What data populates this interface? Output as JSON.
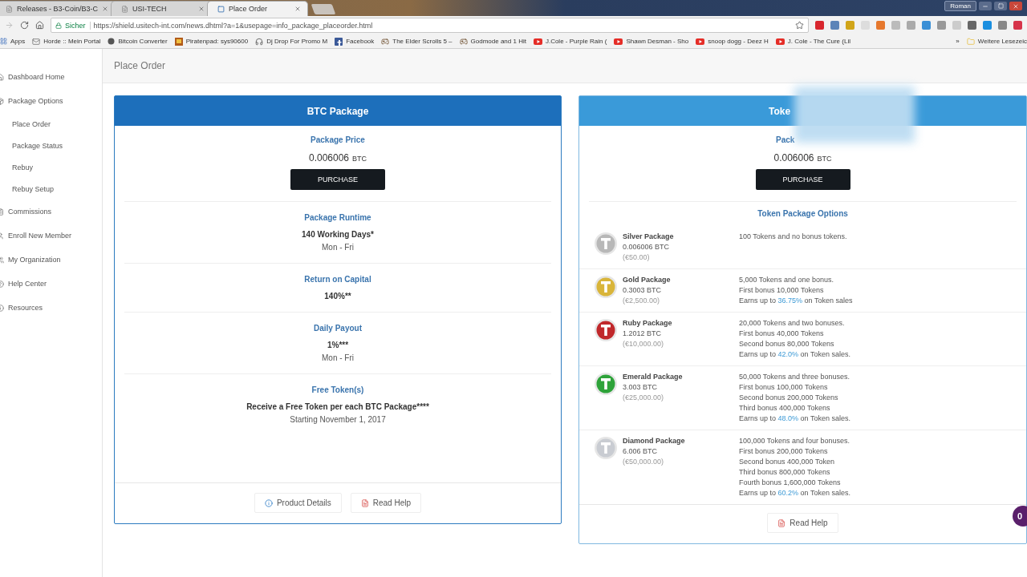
{
  "browser": {
    "tabs": [
      {
        "title": "Releases - B3-Coin/B3-C",
        "selected": false
      },
      {
        "title": "USI-TECH",
        "selected": false
      },
      {
        "title": "Place Order",
        "selected": true
      }
    ],
    "profile": "Roman",
    "address": {
      "security_label": "Sicher",
      "url": "https://shield.usitech-int.com/news.dhtml?a=1&usepage=info_package_placeorder.html"
    },
    "bookmarks": [
      {
        "label": "Apps",
        "kind": "apps"
      },
      {
        "label": "Horde :: Mein Portal",
        "kind": "mail"
      },
      {
        "label": "Bitcoin Converter",
        "kind": "letter"
      },
      {
        "label": "Piratenpad: sys90600",
        "kind": "pad"
      },
      {
        "label": "Dj Drop For Promo M",
        "kind": "headphones"
      },
      {
        "label": "Facebook",
        "kind": "facebook"
      },
      {
        "label": "The Elder Scrolls 5 –",
        "kind": "game"
      },
      {
        "label": "Godmode and 1 Hit",
        "kind": "game"
      },
      {
        "label": "J.Cole - Purple Rain (",
        "kind": "video"
      },
      {
        "label": "Shawn Desman - Sho",
        "kind": "video"
      },
      {
        "label": "snoop dogg - Deez H",
        "kind": "video"
      },
      {
        "label": "J. Cole - The Cure (Lil",
        "kind": "video"
      }
    ],
    "overflow": "»",
    "other_bookmarks": "Weitere Lesezeic"
  },
  "sidebar": {
    "items": [
      {
        "label": "Dashboard Home",
        "kind": "home"
      },
      {
        "label": "Package Options",
        "kind": "package",
        "children": [
          {
            "label": "Place Order"
          },
          {
            "label": "Package Status"
          },
          {
            "label": "Rebuy"
          },
          {
            "label": "Rebuy Setup"
          }
        ]
      },
      {
        "label": "Commissions",
        "kind": "doc"
      },
      {
        "label": "Enroll New Member",
        "kind": "user"
      },
      {
        "label": "My Organization",
        "kind": "users"
      },
      {
        "label": "Help Center",
        "kind": "help"
      },
      {
        "label": "Resources",
        "kind": "info"
      }
    ]
  },
  "page_title": "Place Order",
  "btc_package": {
    "title": "BTC Package",
    "price": {
      "label": "Package Price",
      "amount": "0.006006",
      "unit": "BTC"
    },
    "purchase": "PURCHASE",
    "sections": [
      {
        "label": "Package Runtime",
        "main": "140 Working Days*",
        "sub": "Mon - Fri"
      },
      {
        "label": "Return on Capital",
        "main": "140%**"
      },
      {
        "label": "Daily Payout",
        "main": "1%***",
        "sub": "Mon - Fri"
      },
      {
        "label": "Free Token(s)",
        "main": "Receive a Free Token per each BTC Package****",
        "sub": "Starting November 1, 2017"
      }
    ],
    "footer_buttons": [
      {
        "label": "Product Details",
        "kind": "info"
      },
      {
        "label": "Read Help",
        "kind": "pdf"
      }
    ]
  },
  "token_package": {
    "title": "Toke",
    "price": {
      "label": "Pack",
      "amount": "0.006006",
      "unit": "BTC"
    },
    "purchase": "PURCHASE",
    "options_label": "Token Package Options",
    "packages": [
      {
        "name": "Silver Package",
        "btc": "0.006006 BTC",
        "eur": "(€50.00)",
        "color": "#b8b8b8",
        "lines": [
          "100 Tokens and no bonus tokens."
        ]
      },
      {
        "name": "Gold Package",
        "btc": "0.3003 BTC",
        "eur": "(€2,500.00)",
        "color": "#d9b53a",
        "lines": [
          "5,000 Tokens and one bonus.",
          "First bonus 10,000 Tokens"
        ],
        "earnings": {
          "prefix": "Earns up to ",
          "rate": "36.75%",
          "suffix": " on Token sales"
        }
      },
      {
        "name": "Ruby Package",
        "btc": "1.2012 BTC",
        "eur": "(€10,000.00)",
        "color": "#c0282b",
        "lines": [
          "20,000 Tokens and two bonuses.",
          "First bonus 40,000 Tokens",
          "Second bonus 80,000 Tokens"
        ],
        "earnings": {
          "prefix": "Earns up to ",
          "rate": "42.0%",
          "suffix": " on Token sales."
        }
      },
      {
        "name": "Emerald Package",
        "btc": "3.003 BTC",
        "eur": "(€25,000.00)",
        "color": "#2ea33a",
        "lines": [
          "50,000 Tokens and three bonuses.",
          "First bonus 100,000 Tokens",
          "Second bonus 200,000 Tokens",
          "Third bonus 400,000 Tokens"
        ],
        "earnings": {
          "prefix": "Earns up to ",
          "rate": "48.0%",
          "suffix": " on Token sales."
        }
      },
      {
        "name": "Diamond Package",
        "btc": "6.006 BTC",
        "eur": "(€50,000.00)",
        "color": "#c9ccd2",
        "lines": [
          "100,000 Tokens and four bonuses.",
          "First bonus 200,000 Tokens",
          "Second bonus 400,000 Token",
          "Third bonus 800,000 Tokens",
          "Fourth bonus 1,600,000 Tokens"
        ],
        "earnings": {
          "prefix": "Earns up to ",
          "rate": "60.2%",
          "suffix": " on Token sales."
        }
      }
    ],
    "footer_buttons": [
      {
        "label": "Read Help",
        "kind": "pdf"
      }
    ]
  },
  "chat_badge": "0"
}
